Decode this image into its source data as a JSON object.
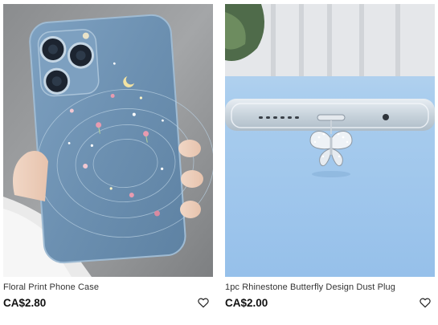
{
  "products": [
    {
      "title": "Floral Print Phone Case",
      "price": "CA$2.80",
      "image_icon": "phone-case-photo",
      "wishlist_icon": "heart-outline-icon"
    },
    {
      "title": "1pc Rhinestone Butterfly Design Dust Plug",
      "price": "CA$2.00",
      "image_icon": "dust-plug-photo",
      "wishlist_icon": "heart-outline-icon"
    }
  ],
  "colors": {
    "price_text": "#111111",
    "title_text": "#333333",
    "case_blue": "#6f93b4",
    "right_bg_blue": "#a9cdee"
  }
}
